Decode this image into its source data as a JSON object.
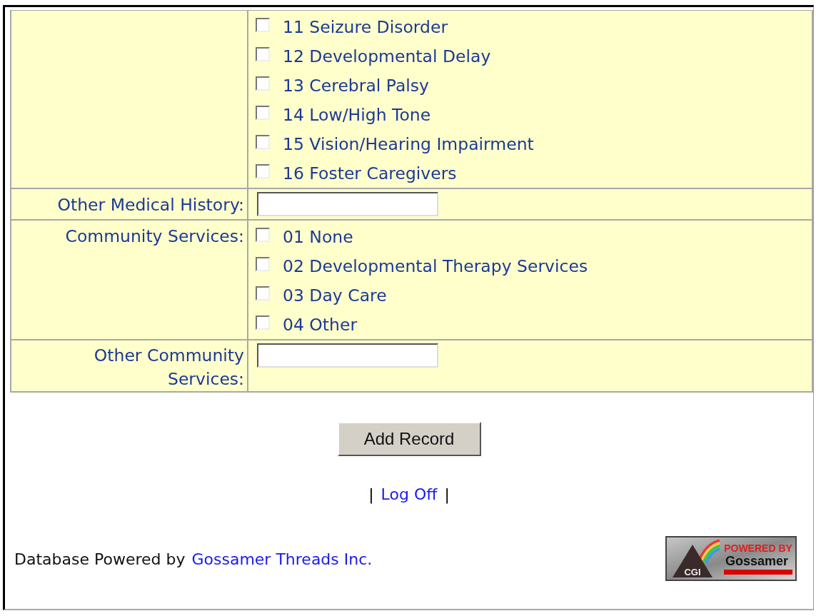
{
  "form": {
    "rows": [
      {
        "kind": "checklist",
        "options": [
          {
            "label": "11 Seizure Disorder",
            "checked": false
          },
          {
            "label": "12 Developmental Delay",
            "checked": false
          },
          {
            "label": "13 Cerebral Palsy",
            "checked": false
          },
          {
            "label": "14 Low/High Tone",
            "checked": false
          },
          {
            "label": "15 Vision/Hearing Impairment",
            "checked": false
          },
          {
            "label": "16 Foster Caregivers",
            "checked": false
          }
        ]
      },
      {
        "kind": "text",
        "label": "Other Medical History:"
      },
      {
        "kind": "checklist",
        "label": "Community Services:",
        "options": [
          {
            "label": "01 None",
            "checked": false
          },
          {
            "label": "02 Developmental Therapy Services",
            "checked": false
          },
          {
            "label": "03 Day Care",
            "checked": false
          },
          {
            "label": "04 Other",
            "checked": false
          }
        ]
      },
      {
        "kind": "text",
        "label": "Other Community Services:"
      }
    ]
  },
  "submit_button": "Add Record",
  "nav": {
    "left_separator": "|",
    "link": "Log Off",
    "right_separator": "|"
  },
  "footer": {
    "text": "Database Powered by",
    "link": "Gossamer Threads Inc."
  },
  "badge": {
    "tagline": "POWERED BY",
    "name": "Gossamer",
    "mark": "CGI"
  }
}
